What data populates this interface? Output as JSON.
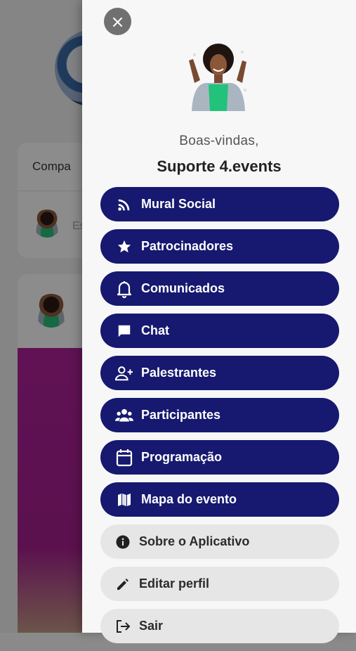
{
  "background": {
    "card_title": "Compa",
    "composer_placeholder": "Es"
  },
  "drawer": {
    "close_icon": "×",
    "welcome": "Boas-vindas,",
    "username": "Suporte 4.events",
    "menu": [
      {
        "label": "Mural Social",
        "icon": "rss-icon",
        "style": "primary"
      },
      {
        "label": "Patrocinadores",
        "icon": "star-icon",
        "style": "primary"
      },
      {
        "label": "Comunicados",
        "icon": "bell-icon",
        "style": "primary"
      },
      {
        "label": "Chat",
        "icon": "chat-icon",
        "style": "primary"
      },
      {
        "label": "Palestrantes",
        "icon": "user-plus-icon",
        "style": "primary"
      },
      {
        "label": "Participantes",
        "icon": "users-icon",
        "style": "primary"
      },
      {
        "label": "Programação",
        "icon": "calendar-icon",
        "style": "primary"
      },
      {
        "label": "Mapa do evento",
        "icon": "map-icon",
        "style": "primary"
      },
      {
        "label": "Sobre o Aplicativo",
        "icon": "info-icon",
        "style": "secondary"
      },
      {
        "label": "Editar perfil",
        "icon": "pencil-icon",
        "style": "secondary"
      },
      {
        "label": "Sair",
        "icon": "logout-icon",
        "style": "secondary"
      }
    ]
  },
  "colors": {
    "primary_button": "#16196f",
    "secondary_button": "#e6e6e6",
    "drawer_background": "#f7f7f7"
  }
}
